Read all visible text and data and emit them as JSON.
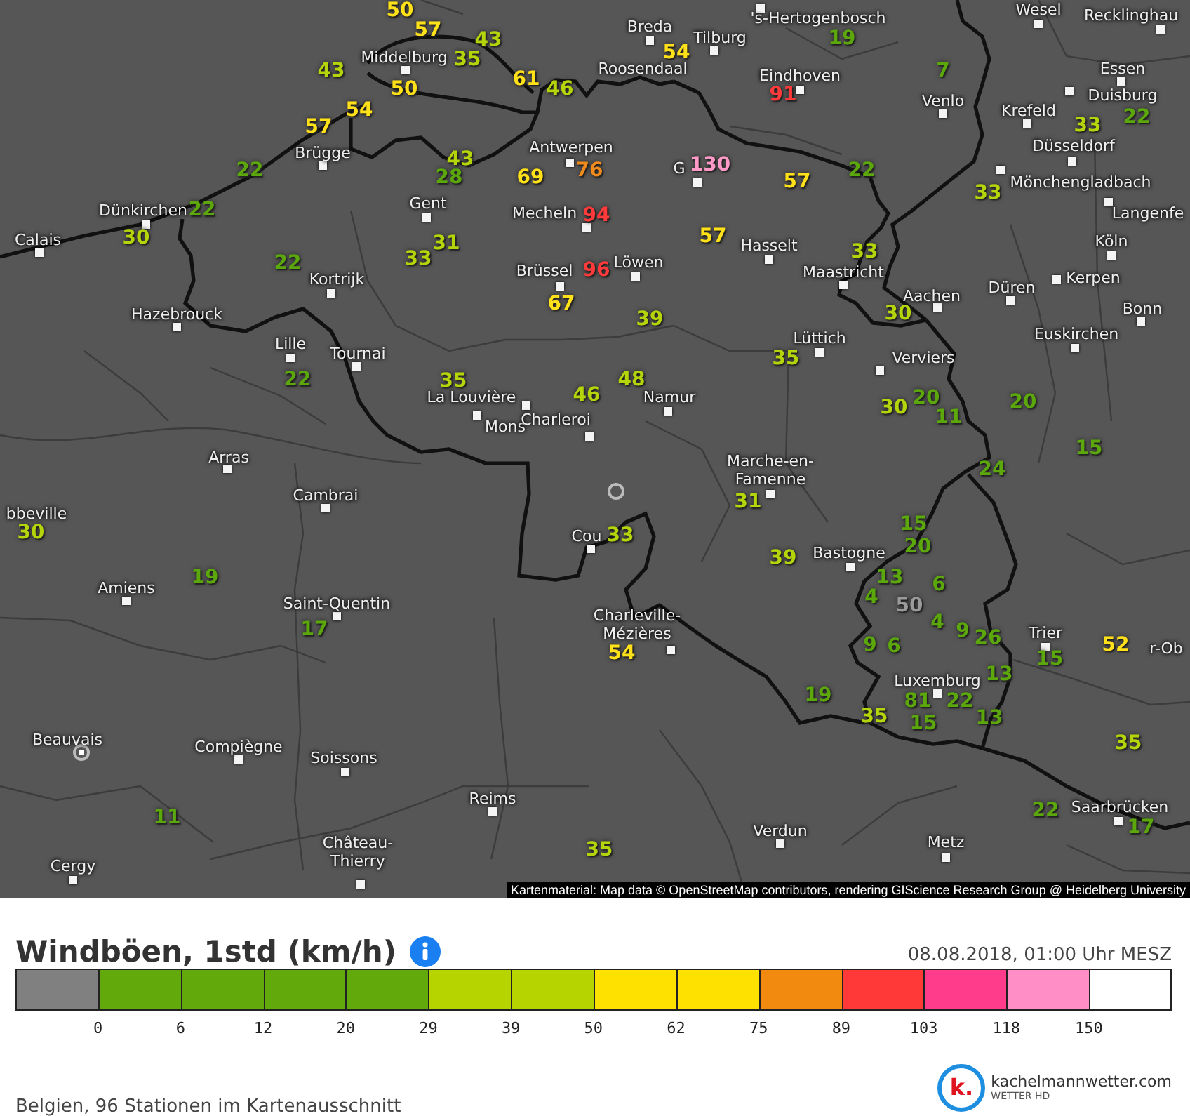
{
  "map": {
    "cities": [
      {
        "name": "'s-Hertogenbosch"
      },
      {
        "name": "Wesel"
      },
      {
        "name": "Breda"
      },
      {
        "name": "Tilburg"
      },
      {
        "name": "Recklinghau"
      },
      {
        "name": "Middelburg"
      },
      {
        "name": "Roosendaal"
      },
      {
        "name": "Eindhoven"
      },
      {
        "name": "Essen"
      },
      {
        "name": "Venlo"
      },
      {
        "name": "Krefeld"
      },
      {
        "name": "Duisburg"
      },
      {
        "name": "Brügge"
      },
      {
        "name": "Antwerpen"
      },
      {
        "name": "Düsseldorf"
      },
      {
        "name": "G"
      },
      {
        "name": "Mönchengladbach"
      },
      {
        "name": "Dünkirchen"
      },
      {
        "name": "Gent"
      },
      {
        "name": "Mecheln"
      },
      {
        "name": "Langenfe"
      },
      {
        "name": "Calais"
      },
      {
        "name": "Hasselt"
      },
      {
        "name": "Köln"
      },
      {
        "name": "Löwen"
      },
      {
        "name": "Kortrijk"
      },
      {
        "name": "Brüssel"
      },
      {
        "name": "Maastricht"
      },
      {
        "name": "Kerpen"
      },
      {
        "name": "Aachen"
      },
      {
        "name": "Düren"
      },
      {
        "name": "Hazebrouck"
      },
      {
        "name": "Bonn"
      },
      {
        "name": "Lille"
      },
      {
        "name": "Lüttich"
      },
      {
        "name": "Euskirchen"
      },
      {
        "name": "Tournai"
      },
      {
        "name": "Verviers"
      },
      {
        "name": "La Louvière"
      },
      {
        "name": "Namur"
      },
      {
        "name": "Mons"
      },
      {
        "name": "Charleroi"
      },
      {
        "name": "Arras"
      },
      {
        "name": "Marche-en-Famenne"
      },
      {
        "name": "Cambrai"
      },
      {
        "name": "bbeville"
      },
      {
        "name": "Cou"
      },
      {
        "name": "Bastogne"
      },
      {
        "name": "Amiens"
      },
      {
        "name": "Saint-Quentin"
      },
      {
        "name": "Charleville-Mézières"
      },
      {
        "name": "Trier"
      },
      {
        "name": "r-Ob"
      },
      {
        "name": "Luxemburg"
      },
      {
        "name": "Beauvais"
      },
      {
        "name": "Compiègne"
      },
      {
        "name": "Soissons"
      },
      {
        "name": "Reims"
      },
      {
        "name": "Saarbrücken"
      },
      {
        "name": "Verdun"
      },
      {
        "name": "Metz"
      },
      {
        "name": "Cergy"
      },
      {
        "name": "Château-Thierry"
      }
    ],
    "stations": [
      {
        "value": "50",
        "color": "#ffe11a"
      },
      {
        "value": "57",
        "color": "#ffe11a"
      },
      {
        "value": "43",
        "color": "#b5d40a"
      },
      {
        "value": "19",
        "color": "#5ba70c"
      },
      {
        "value": "35",
        "color": "#b5d40a"
      },
      {
        "value": "54",
        "color": "#ffe11a"
      },
      {
        "value": "43",
        "color": "#b5d40a"
      },
      {
        "value": "61",
        "color": "#ffe11a"
      },
      {
        "value": "7",
        "color": "#5ba70c"
      },
      {
        "value": "50",
        "color": "#ffe11a"
      },
      {
        "value": "46",
        "color": "#b5d40a"
      },
      {
        "value": "91",
        "color": "#ff3a3a"
      },
      {
        "value": "54",
        "color": "#ffe11a"
      },
      {
        "value": "22",
        "color": "#5ba70c"
      },
      {
        "value": "57",
        "color": "#ffe11a"
      },
      {
        "value": "33",
        "color": "#b5d40a"
      },
      {
        "value": "22",
        "color": "#5ba70c"
      },
      {
        "value": "28",
        "color": "#5ba70c"
      },
      {
        "value": "43",
        "color": "#b5d40a"
      },
      {
        "value": "69",
        "color": "#ffe11a"
      },
      {
        "value": "76",
        "color": "#f08a1c"
      },
      {
        "value": "130",
        "color": "#ff9ac8"
      },
      {
        "value": "57",
        "color": "#ffe11a"
      },
      {
        "value": "22",
        "color": "#5ba70c"
      },
      {
        "value": "33",
        "color": "#b5d40a"
      },
      {
        "value": "22",
        "color": "#5ba70c"
      },
      {
        "value": "94",
        "color": "#ff3a3a"
      },
      {
        "value": "30",
        "color": "#b5d40a"
      },
      {
        "value": "22",
        "color": "#5ba70c"
      },
      {
        "value": "33",
        "color": "#b5d40a"
      },
      {
        "value": "31",
        "color": "#b5d40a"
      },
      {
        "value": "96",
        "color": "#ff3a3a"
      },
      {
        "value": "57",
        "color": "#ffe11a"
      },
      {
        "value": "33",
        "color": "#b5d40a"
      },
      {
        "value": "67",
        "color": "#ffe11a"
      },
      {
        "value": "39",
        "color": "#b5d40a"
      },
      {
        "value": "30",
        "color": "#b5d40a"
      },
      {
        "value": "35",
        "color": "#b5d40a"
      },
      {
        "value": "22",
        "color": "#5ba70c"
      },
      {
        "value": "35",
        "color": "#b5d40a"
      },
      {
        "value": "48",
        "color": "#b5d40a"
      },
      {
        "value": "46",
        "color": "#b5d40a"
      },
      {
        "value": "30",
        "color": "#b5d40a"
      },
      {
        "value": "20",
        "color": "#5ba70c"
      },
      {
        "value": "20",
        "color": "#5ba70c"
      },
      {
        "value": "11",
        "color": "#5ba70c"
      },
      {
        "value": "15",
        "color": "#5ba70c"
      },
      {
        "value": "24",
        "color": "#5ba70c"
      },
      {
        "value": "31",
        "color": "#b5d40a"
      },
      {
        "value": "30",
        "color": "#b5d40a"
      },
      {
        "value": "33",
        "color": "#b5d40a"
      },
      {
        "value": "15",
        "color": "#5ba70c"
      },
      {
        "value": "20",
        "color": "#5ba70c"
      },
      {
        "value": "39",
        "color": "#b5d40a"
      },
      {
        "value": "19",
        "color": "#5ba70c"
      },
      {
        "value": "13",
        "color": "#5ba70c"
      },
      {
        "value": "6",
        "color": "#5ba70c"
      },
      {
        "value": "4",
        "color": "#5ba70c"
      },
      {
        "value": "50",
        "color": "#9a9a9a"
      },
      {
        "value": "17",
        "color": "#5ba70c"
      },
      {
        "value": "54",
        "color": "#ffe11a"
      },
      {
        "value": "9",
        "color": "#5ba70c"
      },
      {
        "value": "6",
        "color": "#5ba70c"
      },
      {
        "value": "4",
        "color": "#5ba70c"
      },
      {
        "value": "9",
        "color": "#5ba70c"
      },
      {
        "value": "26",
        "color": "#5ba70c"
      },
      {
        "value": "15",
        "color": "#5ba70c"
      },
      {
        "value": "52",
        "color": "#ffe11a"
      },
      {
        "value": "13",
        "color": "#5ba70c"
      },
      {
        "value": "19",
        "color": "#5ba70c"
      },
      {
        "value": "81",
        "color": "#5ba70c"
      },
      {
        "value": "22",
        "color": "#5ba70c"
      },
      {
        "value": "35",
        "color": "#b5d40a"
      },
      {
        "value": "15",
        "color": "#5ba70c"
      },
      {
        "value": "13",
        "color": "#5ba70c"
      },
      {
        "value": "35",
        "color": "#b5d40a"
      },
      {
        "value": "11",
        "color": "#5ba70c"
      },
      {
        "value": "22",
        "color": "#5ba70c"
      },
      {
        "value": "17",
        "color": "#5ba70c"
      },
      {
        "value": "35",
        "color": "#b5d40a"
      }
    ],
    "attribution": "Kartenmaterial: Map data © OpenStreetMap contributors, rendering GIScience Research Group @ Heidelberg University"
  },
  "legend": {
    "title": "Windböen, 1std (km/h)",
    "timestamp": "08.08.2018, 01:00 Uhr MESZ",
    "scale": [
      {
        "color": "#808080"
      },
      {
        "color": "#62aa0c"
      },
      {
        "color": "#62aa0c"
      },
      {
        "color": "#62aa0c"
      },
      {
        "color": "#62aa0c"
      },
      {
        "color": "#b6d400"
      },
      {
        "color": "#b6d400"
      },
      {
        "color": "#ffe100"
      },
      {
        "color": "#ffe100"
      },
      {
        "color": "#f28a10"
      },
      {
        "color": "#ff3838"
      },
      {
        "color": "#ff3c8c"
      },
      {
        "color": "#ff8ec6"
      },
      {
        "color": "#ffffff"
      }
    ],
    "ticks": [
      "0",
      "6",
      "12",
      "20",
      "29",
      "39",
      "50",
      "62",
      "75",
      "89",
      "103",
      "118",
      "150"
    ]
  },
  "footer": {
    "summary": "Belgien, 96 Stationen im Kartenausschnitt",
    "logo": {
      "mark": "k.",
      "name": "kachelmannwetter.com",
      "tagline": "WETTER HD"
    }
  }
}
